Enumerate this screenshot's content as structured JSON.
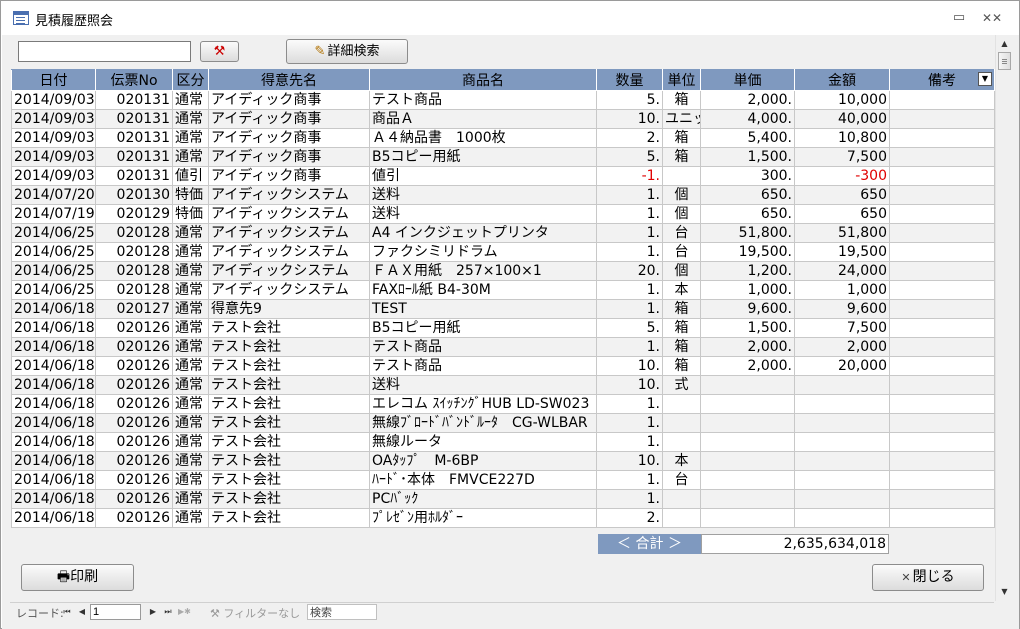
{
  "window": {
    "title": "見積履歴照会"
  },
  "toolbar": {
    "search_value": "",
    "clear_icon": "filter-clear-icon",
    "detail_label": "詳細検索"
  },
  "table": {
    "headers": [
      "日付",
      "伝票No",
      "区分",
      "得意先名",
      "商品名",
      "数量",
      "単位",
      "単価",
      "金額",
      "備考"
    ],
    "rows": [
      [
        "2014/09/03",
        "020131",
        "通常",
        "アイディック商事",
        "テスト商品",
        "5.",
        "箱",
        "2,000.",
        "10,000",
        ""
      ],
      [
        "2014/09/03",
        "020131",
        "通常",
        "アイディック商事",
        "商品Ａ",
        "10.",
        "ユニット",
        "4,000.",
        "40,000",
        ""
      ],
      [
        "2014/09/03",
        "020131",
        "通常",
        "アイディック商事",
        "Ａ４納品書　1000枚",
        "2.",
        "箱",
        "5,400.",
        "10,800",
        ""
      ],
      [
        "2014/09/03",
        "020131",
        "通常",
        "アイディック商事",
        "B5コピー用紙",
        "5.",
        "箱",
        "1,500.",
        "7,500",
        ""
      ],
      [
        "2014/09/03",
        "020131",
        "値引",
        "アイディック商事",
        "値引",
        "-1.",
        "",
        "300.",
        "-300",
        ""
      ],
      [
        "2014/07/20",
        "020130",
        "特価",
        "アイディックシステム",
        "送料",
        "1.",
        "個",
        "650.",
        "650",
        ""
      ],
      [
        "2014/07/19",
        "020129",
        "特価",
        "アイディックシステム",
        "送料",
        "1.",
        "個",
        "650.",
        "650",
        ""
      ],
      [
        "2014/06/25",
        "020128",
        "通常",
        "アイディックシステム",
        "A4 インクジェットプリンタ",
        "1.",
        "台",
        "51,800.",
        "51,800",
        ""
      ],
      [
        "2014/06/25",
        "020128",
        "通常",
        "アイディックシステム",
        "ファクシミリドラム",
        "1.",
        "台",
        "19,500.",
        "19,500",
        ""
      ],
      [
        "2014/06/25",
        "020128",
        "通常",
        "アイディックシステム",
        "ＦＡＸ用紙　257×100×1",
        "20.",
        "個",
        "1,200.",
        "24,000",
        ""
      ],
      [
        "2014/06/25",
        "020128",
        "通常",
        "アイディックシステム",
        "FAXﾛｰﾙ紙 B4-30M",
        "1.",
        "本",
        "1,000.",
        "1,000",
        ""
      ],
      [
        "2014/06/18",
        "020127",
        "通常",
        "得意先9",
        "TEST",
        "1.",
        "箱",
        "9,600.",
        "9,600",
        ""
      ],
      [
        "2014/06/18",
        "020126",
        "通常",
        "テスト会社",
        "B5コピー用紙",
        "5.",
        "箱",
        "1,500.",
        "7,500",
        ""
      ],
      [
        "2014/06/18",
        "020126",
        "通常",
        "テスト会社",
        "テスト商品",
        "1.",
        "箱",
        "2,000.",
        "2,000",
        ""
      ],
      [
        "2014/06/18",
        "020126",
        "通常",
        "テスト会社",
        "テスト商品",
        "10.",
        "箱",
        "2,000.",
        "20,000",
        ""
      ],
      [
        "2014/06/18",
        "020126",
        "通常",
        "テスト会社",
        "送料",
        "10.",
        "式",
        "",
        "",
        ""
      ],
      [
        "2014/06/18",
        "020126",
        "通常",
        "テスト会社",
        "エレコム ｽｲｯﾁﾝｸﾞHUB LD-SW023",
        "1.",
        "",
        "",
        "",
        ""
      ],
      [
        "2014/06/18",
        "020126",
        "通常",
        "テスト会社",
        "無線ﾌﾞﾛｰﾄﾞﾊﾞﾝﾄﾞﾙｰﾀ　CG-WLBAR",
        "1.",
        "",
        "",
        "",
        ""
      ],
      [
        "2014/06/18",
        "020126",
        "通常",
        "テスト会社",
        "無線ルータ",
        "1.",
        "",
        "",
        "",
        ""
      ],
      [
        "2014/06/18",
        "020126",
        "通常",
        "テスト会社",
        "OAﾀｯﾌﾟ　M-6BP",
        "10.",
        "本",
        "",
        "",
        ""
      ],
      [
        "2014/06/18",
        "020126",
        "通常",
        "テスト会社",
        "ﾊｰﾄﾞ･本体　FMVCE227D",
        "1.",
        "台",
        "",
        "",
        ""
      ],
      [
        "2014/06/18",
        "020126",
        "通常",
        "テスト会社",
        "PCﾊﾞｯｸ",
        "1.",
        "",
        "",
        "",
        ""
      ],
      [
        "2014/06/18",
        "020126",
        "通常",
        "テスト会社",
        "ﾌﾟﾚｾﾞﾝ用ﾎﾙﾀﾞｰ",
        "2.",
        "",
        "",
        "",
        ""
      ]
    ]
  },
  "totals": {
    "label": "＜ 合計 ＞",
    "value": "2,635,634,018"
  },
  "buttons": {
    "print_label": "印刷",
    "close_label": "閉じる"
  },
  "navbar": {
    "record_label": "レコード:",
    "current": "1",
    "filter_label": "フィルターなし",
    "search_label": "検索"
  },
  "colors": {
    "header_bg": "#7f99bf",
    "negative": "#e00000"
  }
}
